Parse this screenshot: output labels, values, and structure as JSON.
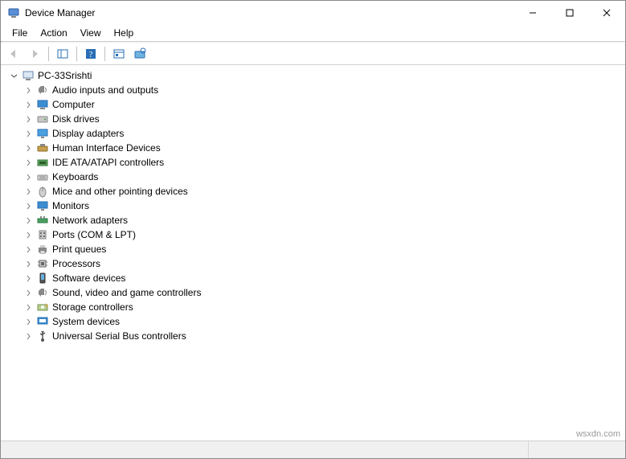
{
  "window": {
    "title": "Device Manager"
  },
  "menu": {
    "file": "File",
    "action": "Action",
    "view": "View",
    "help": "Help"
  },
  "tree": {
    "root": "PC-33Srishti",
    "nodes": [
      "Audio inputs and outputs",
      "Computer",
      "Disk drives",
      "Display adapters",
      "Human Interface Devices",
      "IDE ATA/ATAPI controllers",
      "Keyboards",
      "Mice and other pointing devices",
      "Monitors",
      "Network adapters",
      "Ports (COM & LPT)",
      "Print queues",
      "Processors",
      "Software devices",
      "Sound, video and game controllers",
      "Storage controllers",
      "System devices",
      "Universal Serial Bus controllers"
    ]
  },
  "watermark": "wsxdn.com"
}
